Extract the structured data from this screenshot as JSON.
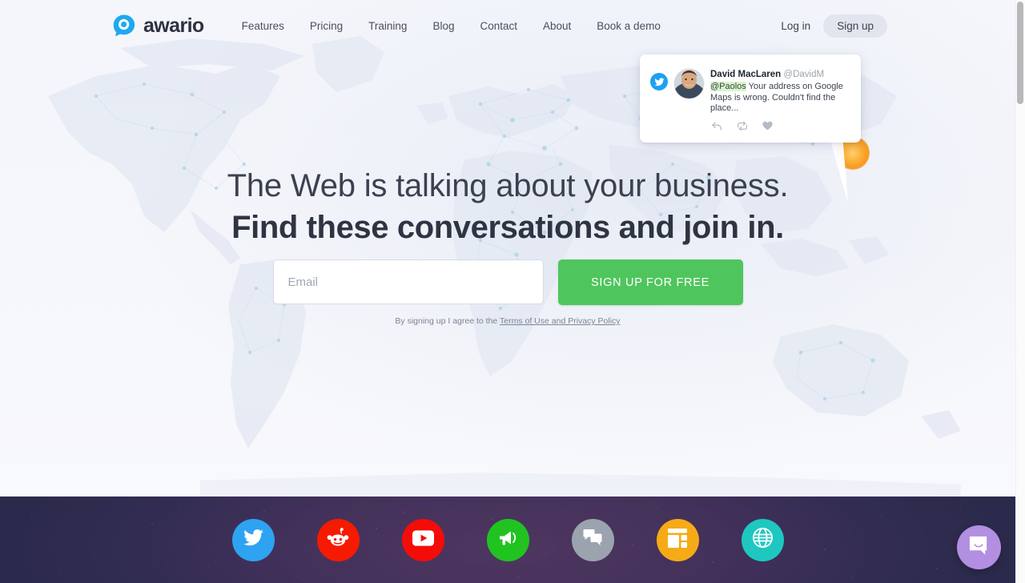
{
  "brand": {
    "name": "awario",
    "logo_icon": "awario-speech-bubble-search-logo",
    "logo_color": "#1fa8f0"
  },
  "nav": {
    "links": [
      {
        "label": "Features"
      },
      {
        "label": "Pricing"
      },
      {
        "label": "Training"
      },
      {
        "label": "Blog"
      },
      {
        "label": "Contact"
      },
      {
        "label": "About"
      },
      {
        "label": "Book a demo"
      }
    ],
    "login_label": "Log in",
    "signup_label": "Sign up"
  },
  "tweet_card": {
    "network_icon": "twitter-bird-icon",
    "avatar_icon": "user-avatar",
    "author_name": "David MacLaren",
    "author_handle": "@DavidM",
    "mention": "@Paolos",
    "text": " Your address on Google Maps is wrong. Couldn't find the place...",
    "actions": [
      {
        "icon": "reply-icon"
      },
      {
        "icon": "retweet-icon"
      },
      {
        "icon": "heart-icon"
      }
    ],
    "pin_icon": "map-pin-glow",
    "pin_color": "#f79a21"
  },
  "hero": {
    "headline_line1": "The Web is talking about your business.",
    "headline_line2": "Find these conversations and join in.",
    "email_placeholder": "Email",
    "email_value": "",
    "cta_label": "SIGN UP FOR FREE",
    "terms_prefix": "By signing up I agree to the ",
    "terms_link": "Terms of Use and Privacy Policy",
    "cta_color": "#4fc65d",
    "background_icon": "world-map-network-background"
  },
  "footer": {
    "background_color": "#42315a",
    "social": [
      {
        "name": "twitter",
        "icon": "twitter-icon",
        "color": "#2ea3f2"
      },
      {
        "name": "reddit",
        "icon": "reddit-icon",
        "color": "#f61b00"
      },
      {
        "name": "youtube",
        "icon": "youtube-icon",
        "color": "#f40c09"
      },
      {
        "name": "news",
        "icon": "megaphone-icon",
        "color": "#21c321"
      },
      {
        "name": "forums",
        "icon": "comments-icon",
        "color": "#9ba3ae"
      },
      {
        "name": "blogs",
        "icon": "layout-icon",
        "color": "#f6ab16"
      },
      {
        "name": "web",
        "icon": "globe-icon",
        "color": "#1ec8c0"
      }
    ]
  },
  "chat_widget": {
    "icon": "intercom-chat-smile-icon",
    "color": "#b28fe0"
  },
  "scrollbar": {
    "icon": "vertical-scrollbar"
  }
}
